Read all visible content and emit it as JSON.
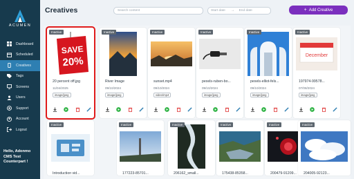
{
  "app": {
    "brand": "ACUMEN"
  },
  "sidebar": {
    "items": [
      {
        "label": "Dashboard",
        "icon": "dashboard-icon"
      },
      {
        "label": "Scheduled",
        "icon": "calendar-icon"
      },
      {
        "label": "Creatives",
        "icon": "phone-icon",
        "active": true
      },
      {
        "label": "Tags",
        "icon": "tag-icon"
      },
      {
        "label": "Screens",
        "icon": "monitor-icon"
      },
      {
        "label": "Users",
        "icon": "users-icon"
      },
      {
        "label": "Support",
        "icon": "support-icon"
      },
      {
        "label": "Account",
        "icon": "account-icon"
      },
      {
        "label": "Logout",
        "icon": "logout-icon"
      }
    ],
    "greeting": "Hello, Adonmo CMS Test Counterpart !"
  },
  "header": {
    "title": "Creatives",
    "search_placeholder": "Search content",
    "start_date_placeholder": "Start date",
    "end_date_placeholder": "End date",
    "add_label": "Add Creative"
  },
  "cards_row1": [
    {
      "status": "Inactive",
      "name": "20 percent off.jpg",
      "date": "11/04/2025",
      "type": "image/jpeg"
    },
    {
      "status": "Inactive",
      "name": "River Image",
      "date": "09/10/2024",
      "type": "image/jpeg"
    },
    {
      "status": "Inactive",
      "name": "sunset.mp4",
      "date": "09/10/2024",
      "type": "video/mp4"
    },
    {
      "status": "Inactive",
      "name": "pexels-ruben-bo...",
      "date": "09/10/2024",
      "type": "image/jpeg"
    },
    {
      "status": "Inactive",
      "name": "pexels-elliot-fels...",
      "date": "09/10/2024",
      "type": "image/jpeg"
    },
    {
      "status": "Inactive",
      "name": "197974-99578...",
      "date": "07/08/2024",
      "type": "image/jpeg"
    }
  ],
  "cards_row2": [
    {
      "status": "Inactive",
      "name": "Introduction vid..."
    },
    {
      "status": "Inactive",
      "name": "177223-85701..."
    },
    {
      "status": "Inactive",
      "name": "206162_small..."
    },
    {
      "status": "Inactive",
      "name": "175438-85358..."
    },
    {
      "status": "Inactive",
      "name": "200479-91209..."
    },
    {
      "status": "Inactive",
      "name": "204005-92123..."
    }
  ],
  "colors": {
    "sidebar": "#173a4d",
    "active": "#2e7fb2",
    "accent": "#7b2fbe",
    "selected_border": "#e01b1b",
    "play": "#2fb344",
    "delete": "#e03b3b",
    "edit": "#2e7fb2"
  }
}
